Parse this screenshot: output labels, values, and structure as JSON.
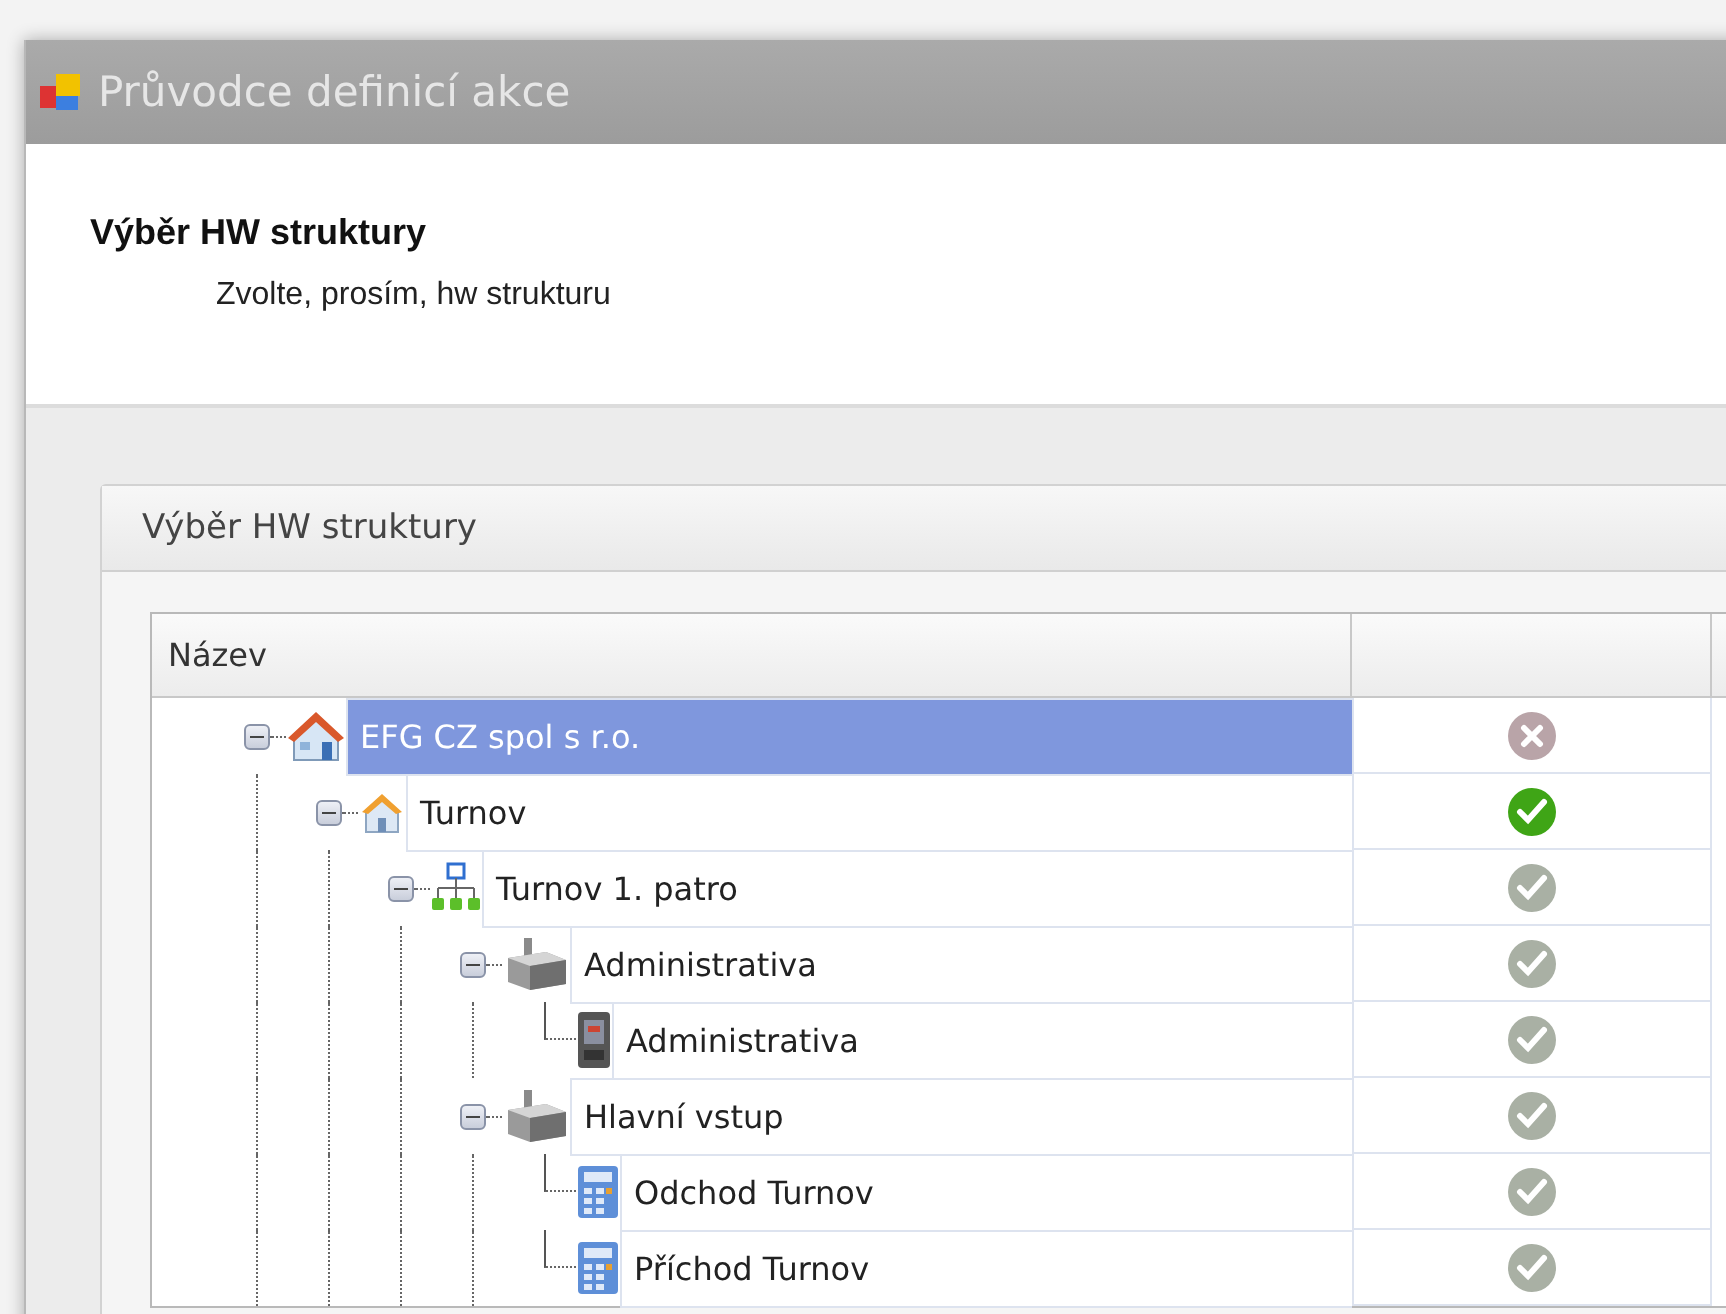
{
  "window": {
    "title": "Průvodce definicí akce"
  },
  "header": {
    "title": "Výběr HW struktury",
    "subtitle": "Zvolte, prosím, hw strukturu"
  },
  "group": {
    "title": "Výběr HW struktury"
  },
  "table": {
    "columns": [
      "Název"
    ],
    "tree": [
      {
        "label": "EFG CZ spol s r.o.",
        "kind": "company",
        "valid": false,
        "active": false,
        "selected": true,
        "expanded": true,
        "children": [
          {
            "label": "Turnov",
            "kind": "branch",
            "valid": true,
            "active": true,
            "selected": false,
            "expanded": true,
            "children": [
              {
                "label": "Turnov 1. patro",
                "kind": "network",
                "valid": true,
                "active": false,
                "selected": false,
                "expanded": true,
                "children": [
                  {
                    "label": "Administrativa",
                    "kind": "controller",
                    "valid": true,
                    "active": false,
                    "selected": false,
                    "expanded": true,
                    "children": [
                      {
                        "label": "Administrativa",
                        "kind": "terminal",
                        "valid": true,
                        "active": false,
                        "selected": false
                      }
                    ]
                  },
                  {
                    "label": "Hlavní vstup",
                    "kind": "controller",
                    "valid": true,
                    "active": false,
                    "selected": false,
                    "expanded": true,
                    "children": [
                      {
                        "label": "Odchod Turnov",
                        "kind": "reader",
                        "valid": true,
                        "active": false,
                        "selected": false
                      },
                      {
                        "label": "Příchod Turnov",
                        "kind": "reader",
                        "valid": true,
                        "active": false,
                        "selected": false
                      }
                    ]
                  }
                ]
              }
            ]
          }
        ]
      }
    ]
  }
}
